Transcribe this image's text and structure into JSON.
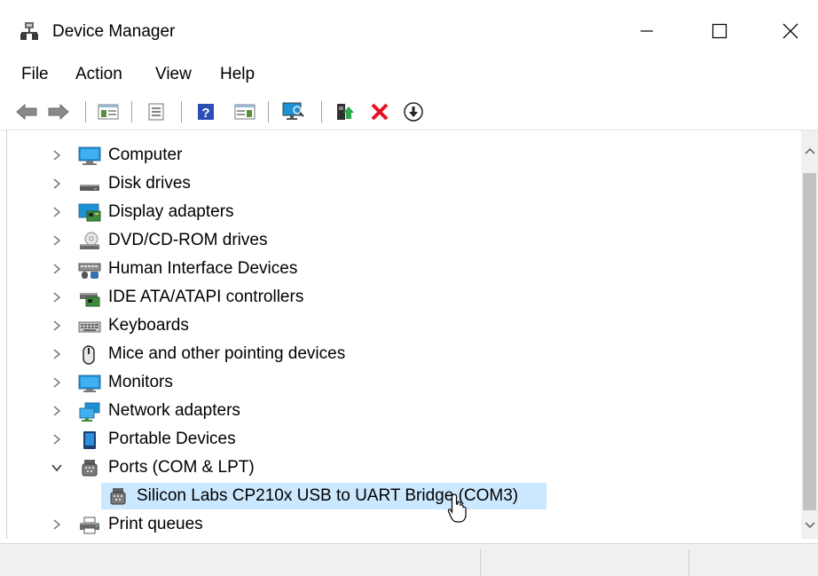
{
  "window": {
    "title": "Device Manager",
    "controls": {
      "minimize": "minimize",
      "maximize": "maximize",
      "close": "close"
    }
  },
  "menu": {
    "items": [
      "File",
      "Action",
      "View",
      "Help"
    ]
  },
  "toolbar": {
    "icons": [
      "back-arrow-icon",
      "forward-arrow-icon",
      "show-hide-console-tree-icon",
      "properties-icon",
      "help-icon",
      "action-pane-icon",
      "scan-hardware-icon",
      "update-driver-icon",
      "uninstall-device-icon",
      "disable-device-icon"
    ]
  },
  "tree": {
    "items": [
      {
        "label": "Computer",
        "icon": "computer-icon",
        "expanded": false
      },
      {
        "label": "Disk drives",
        "icon": "disk-drive-icon",
        "expanded": false
      },
      {
        "label": "Display adapters",
        "icon": "display-adapter-icon",
        "expanded": false
      },
      {
        "label": "DVD/CD-ROM drives",
        "icon": "dvd-drive-icon",
        "expanded": false
      },
      {
        "label": "Human Interface Devices",
        "icon": "hid-icon",
        "expanded": false
      },
      {
        "label": "IDE ATA/ATAPI controllers",
        "icon": "ide-controller-icon",
        "expanded": false
      },
      {
        "label": "Keyboards",
        "icon": "keyboard-icon",
        "expanded": false
      },
      {
        "label": "Mice and other pointing devices",
        "icon": "mouse-icon",
        "expanded": false
      },
      {
        "label": "Monitors",
        "icon": "monitor-icon",
        "expanded": false
      },
      {
        "label": "Network adapters",
        "icon": "network-adapter-icon",
        "expanded": false
      },
      {
        "label": "Portable Devices",
        "icon": "portable-device-icon",
        "expanded": false
      },
      {
        "label": "Ports (COM & LPT)",
        "icon": "port-icon",
        "expanded": true
      },
      {
        "label": "Silicon Labs CP210x USB to UART Bridge (COM3)",
        "icon": "port-icon",
        "child": true,
        "selected": true
      },
      {
        "label": "Print queues",
        "icon": "printer-icon",
        "expanded": false
      }
    ]
  },
  "colors": {
    "selection": "#cce8ff",
    "monitor_blue": "#1e90d6",
    "uninstall_red": "#e81123"
  }
}
